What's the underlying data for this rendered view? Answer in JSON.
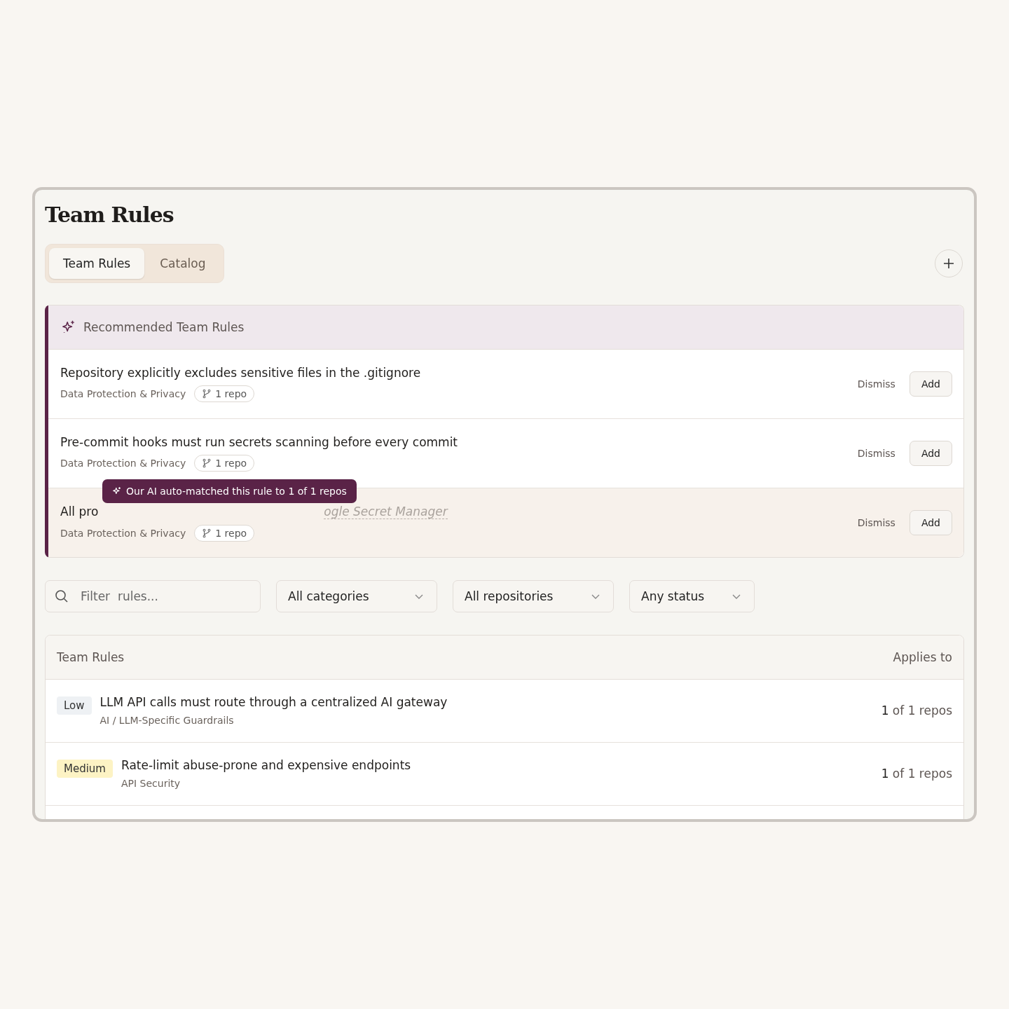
{
  "page": {
    "title": "Team Rules"
  },
  "tabs": [
    {
      "label": "Team Rules",
      "selected": true
    },
    {
      "label": "Catalog",
      "selected": false
    }
  ],
  "recommended": {
    "title": "Recommended Team Rules",
    "rules": [
      {
        "title": "Repository explicitly excludes sensitive files in the .gitignore",
        "category": "Data Protection & Privacy",
        "repos": "1 repo",
        "highlighted": false,
        "dismiss": "Dismiss",
        "add": "Add"
      },
      {
        "title": "Pre-commit hooks must run secrets scanning before every commit",
        "category": "Data Protection & Privacy",
        "repos": "1 repo",
        "highlighted": false,
        "dismiss": "Dismiss",
        "add": "Add"
      },
      {
        "title": "All pro",
        "title_tail": "ogle Secret Manager",
        "tooltip": "Our AI auto-matched this rule to 1 of 1 repos",
        "category": "Data Protection & Privacy",
        "repos": "1 repo",
        "highlighted": true,
        "dismiss": "Dismiss",
        "add": "Add"
      }
    ]
  },
  "filters": {
    "search": {
      "placeholder": "Filter  rules..."
    },
    "dropdowns": [
      "All categories",
      "All repositories",
      "Any status"
    ]
  },
  "table": {
    "columns": [
      "Team Rules",
      "Applies to"
    ],
    "rows": [
      {
        "severity": "Low",
        "color": "#eef1f4",
        "title": "LLM API calls must route through a centralized AI gateway",
        "category": "AI / LLM-Specific Guardrails",
        "applies": "**1** of 1 repos"
      },
      {
        "severity": "Medium",
        "color": "#fdf3c4",
        "title": "Rate-limit abuse-prone and expensive endpoints",
        "category": "API Security",
        "applies": "**1** of 1 repos"
      }
    ]
  }
}
